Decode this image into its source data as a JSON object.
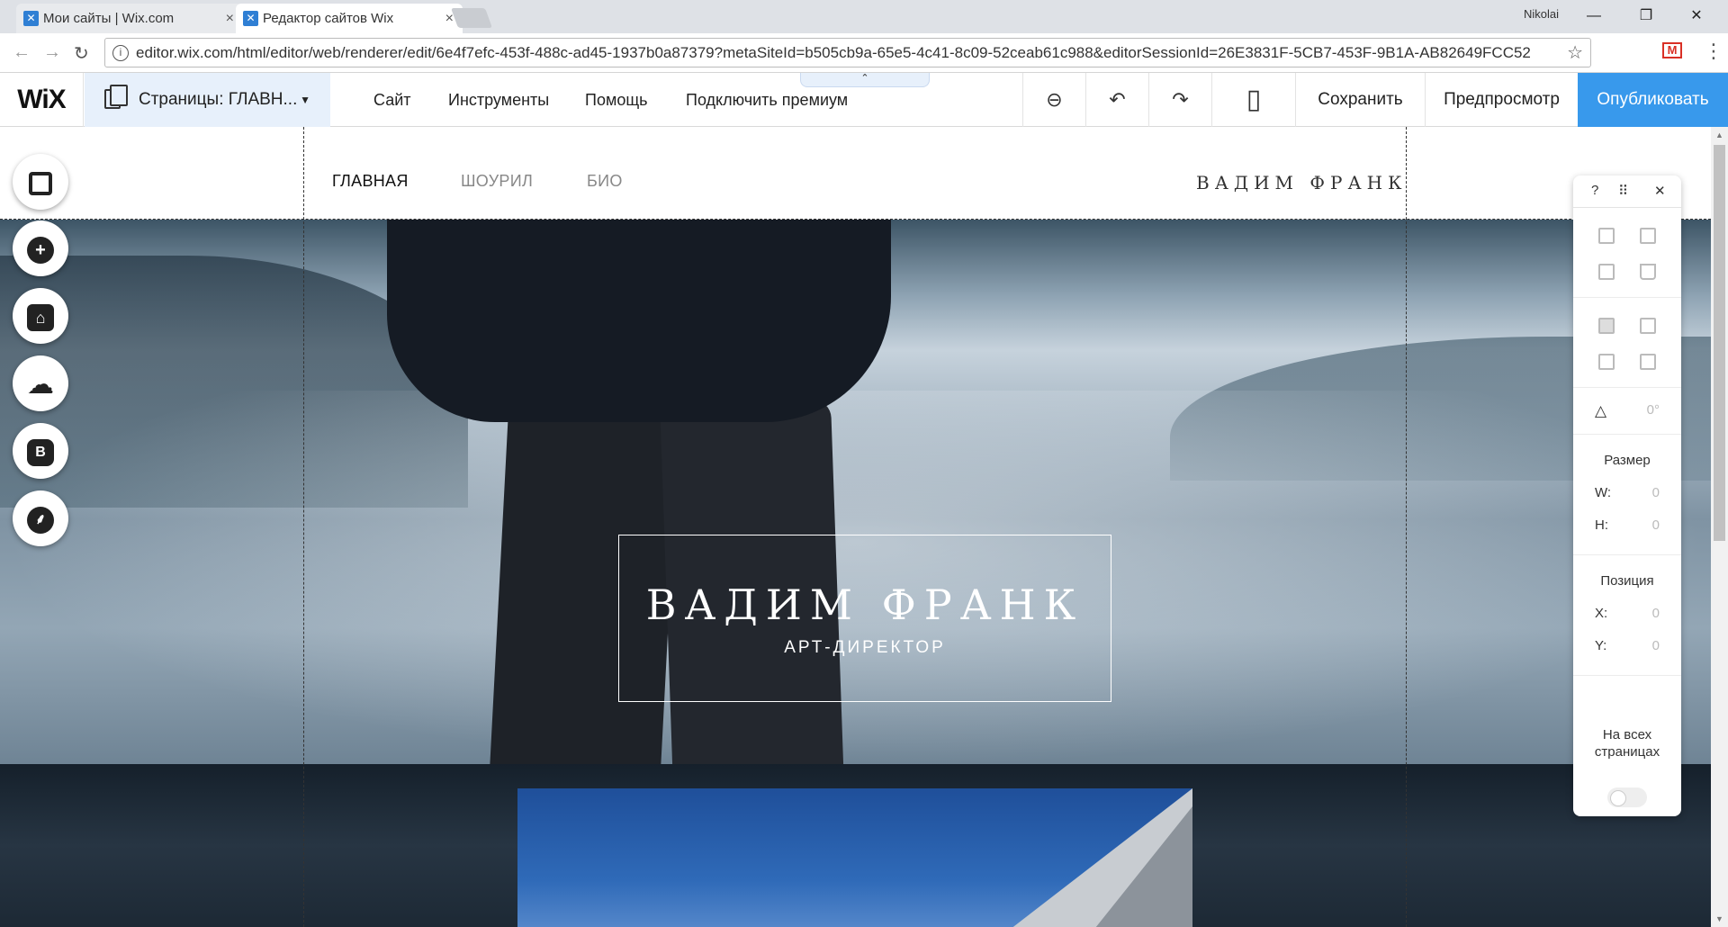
{
  "browser": {
    "tabs": [
      {
        "title": "Мои сайты | Wix.com",
        "active": false
      },
      {
        "title": "Редактор сайтов Wix",
        "active": true
      }
    ],
    "user": "Nikolai",
    "url": "editor.wix.com/html/editor/web/renderer/edit/6e4f7efc-453f-488c-ad45-1937b0a87379?metaSiteId=b505cb9a-65e5-4c41-8c09-52ceab61c988&editorSessionId=26E3831F-5CB7-453F-9B1A-AB82649FCC52",
    "close_glyph": "×",
    "window_controls": [
      "—",
      "❐",
      "✕"
    ],
    "nav_icons": [
      "←",
      "→",
      "↻"
    ],
    "star_glyph": "☆",
    "gmail_letter": "M",
    "menu_glyph": "⋮"
  },
  "editor": {
    "logo": "WiX",
    "pages_dropdown": "Страницы: ГЛАВН...",
    "menu": [
      "Сайт",
      "Инструменты",
      "Помощь",
      "Подключить премиум"
    ],
    "collapse_glyph": "⌃",
    "tools": {
      "zoom": "⊖",
      "undo": "↶",
      "redo": "↷",
      "mobile": "▯"
    },
    "save": "Сохранить",
    "preview": "Предпросмотр",
    "publish": "Опубликовать",
    "accent_color": "#3899ec"
  },
  "site": {
    "nav": [
      "ГЛАВНАЯ",
      "ШОУРИЛ",
      "БИО"
    ],
    "brand": "ВАДИМ ФРАНК",
    "hero_title": "ВАДИМ ФРАНК",
    "hero_subtitle": "АРТ-ДИРЕКТОР"
  },
  "rail": {
    "icons": [
      "background-icon",
      "add-icon",
      "app-market-icon",
      "upload-icon",
      "blog-icon",
      "chat-icon"
    ],
    "glyphs": [
      "▢",
      "+",
      "⌂",
      "☁",
      "B",
      "⸙"
    ]
  },
  "inspector": {
    "help": "?",
    "drag": "⠿",
    "close": "✕",
    "rotation": "0°",
    "size_label": "Размер",
    "w_label": "W:",
    "w_value": "0",
    "h_label": "H:",
    "h_value": "0",
    "position_label": "Позиция",
    "x_label": "X:",
    "x_value": "0",
    "y_label": "Y:",
    "y_value": "0",
    "all_pages_label": "На всех страницах",
    "all_pages_on": false
  }
}
